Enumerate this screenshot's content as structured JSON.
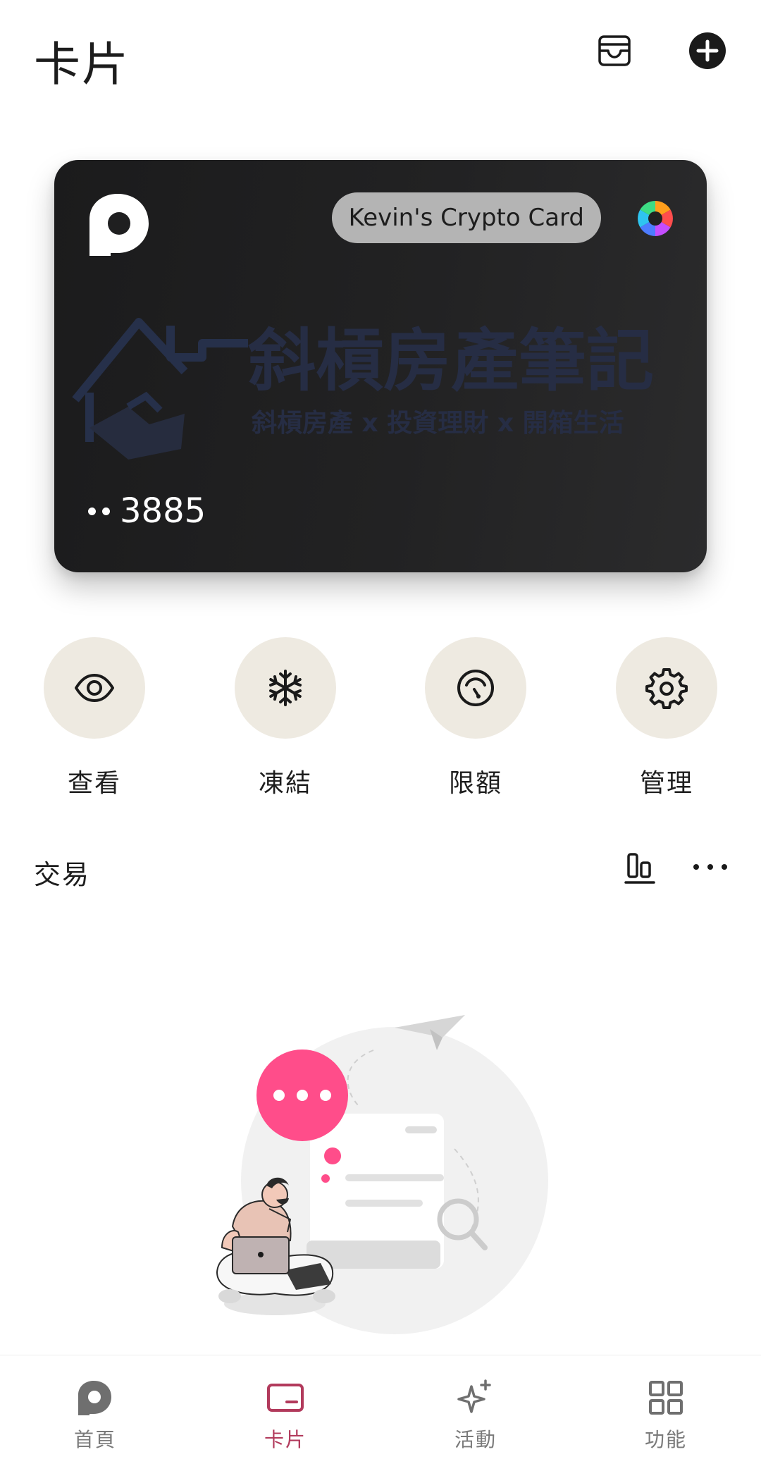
{
  "header": {
    "title": "卡片",
    "wallet_icon": "wallet-icon",
    "add_icon": "plus-circle-icon"
  },
  "card": {
    "logo_icon": "p-logo-icon",
    "name": "Kevin's Crypto Card",
    "color_icon": "color-wheel-icon",
    "masked_dots": "••",
    "last4": "3885",
    "watermark": {
      "title": "斜槓房產筆記",
      "subtitle": "斜槓房產 x 投資理財 x 開箱生活"
    }
  },
  "actions": [
    {
      "label": "查看",
      "icon": "eye-icon"
    },
    {
      "label": "凍結",
      "icon": "snowflake-icon"
    },
    {
      "label": "限額",
      "icon": "speedometer-icon"
    },
    {
      "label": "管理",
      "icon": "gear-icon"
    }
  ],
  "transactions": {
    "title": "交易",
    "chart_icon": "bar-chart-icon",
    "more_icon": "more-horizontal-icon"
  },
  "bottom_nav": [
    {
      "label": "首頁",
      "icon": "p-logo-icon",
      "active": false
    },
    {
      "label": "卡片",
      "icon": "card-icon",
      "active": true
    },
    {
      "label": "活動",
      "icon": "sparkle-icon",
      "active": false
    },
    {
      "label": "功能",
      "icon": "grid-icon",
      "active": false
    }
  ],
  "colors": {
    "accent": "#b23a5c",
    "card_bg": "#1f1f20",
    "action_bg": "#eeeae1",
    "pink": "#ff4d8a"
  }
}
